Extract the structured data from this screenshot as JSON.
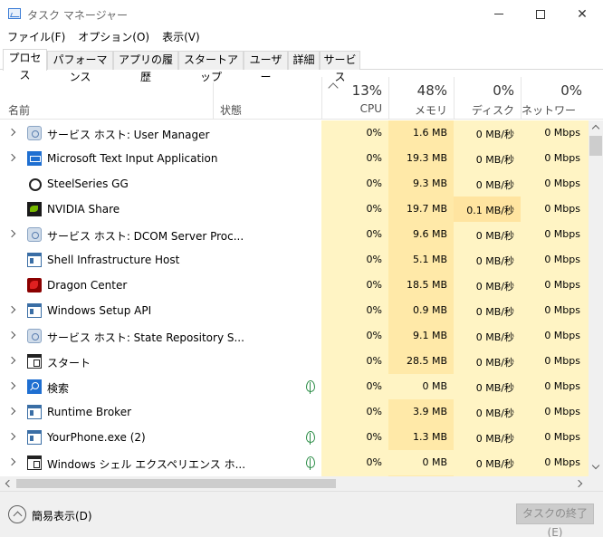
{
  "window": {
    "title": "タスク マネージャー",
    "minimize_icon": "minimize-icon",
    "maximize_icon": "maximize-icon",
    "close_glyph": "✕"
  },
  "menu": [
    "ファイル(F)",
    "オプション(O)",
    "表示(V)"
  ],
  "tabs": [
    "プロセス",
    "パフォーマンス",
    "アプリの履歴",
    "スタートアップ",
    "ユーザー",
    "詳細",
    "サービス"
  ],
  "active_tab": "プロセス",
  "columns": {
    "name": "名前",
    "status": "状態",
    "cpu": {
      "pct": "13%",
      "label": "CPU"
    },
    "memory": {
      "pct": "48%",
      "label": "メモリ"
    },
    "disk": {
      "pct": "0%",
      "label": "ディスク"
    },
    "network": {
      "pct": "0%",
      "label": "ネットワーク"
    }
  },
  "colors": {
    "cpu_column_bg": "#fff4c4",
    "memory_column_bg": "#ffe9a8",
    "highlight_cell_bg": "#ffe4a0",
    "status_leaf": "#2f8f4a"
  },
  "processes": [
    {
      "expandable": true,
      "icon": "gear-icon",
      "name": "サービス ホスト: User Manager",
      "suspended": false,
      "cpu": "0%",
      "memory": "1.6 MB",
      "disk": "0 MB/秒",
      "network": "0 Mbps"
    },
    {
      "expandable": true,
      "icon": "keyboard-icon",
      "name": "Microsoft Text Input Application",
      "suspended": false,
      "cpu": "0%",
      "memory": "19.3 MB",
      "disk": "0 MB/秒",
      "network": "0 Mbps"
    },
    {
      "expandable": false,
      "icon": "steelseries-icon",
      "name": "SteelSeries GG",
      "suspended": false,
      "cpu": "0%",
      "memory": "9.3 MB",
      "disk": "0 MB/秒",
      "network": "0 Mbps"
    },
    {
      "expandable": false,
      "icon": "nvidia-icon",
      "name": "NVIDIA Share",
      "suspended": false,
      "cpu": "0%",
      "memory": "19.7 MB",
      "disk": "0.1 MB/秒",
      "network": "0 Mbps"
    },
    {
      "expandable": true,
      "icon": "gear-icon",
      "name": "サービス ホスト: DCOM Server Proc...",
      "suspended": false,
      "cpu": "0%",
      "memory": "9.6 MB",
      "disk": "0 MB/秒",
      "network": "0 Mbps"
    },
    {
      "expandable": false,
      "icon": "window-icon",
      "name": "Shell Infrastructure Host",
      "suspended": false,
      "cpu": "0%",
      "memory": "5.1 MB",
      "disk": "0 MB/秒",
      "network": "0 Mbps"
    },
    {
      "expandable": false,
      "icon": "dragon-icon",
      "name": "Dragon Center",
      "suspended": false,
      "cpu": "0%",
      "memory": "18.5 MB",
      "disk": "0 MB/秒",
      "network": "0 Mbps"
    },
    {
      "expandable": true,
      "icon": "window-icon",
      "name": "Windows Setup API",
      "suspended": false,
      "cpu": "0%",
      "memory": "0.9 MB",
      "disk": "0 MB/秒",
      "network": "0 Mbps"
    },
    {
      "expandable": true,
      "icon": "gear-icon",
      "name": "サービス ホスト: State Repository S...",
      "suspended": false,
      "cpu": "0%",
      "memory": "9.1 MB",
      "disk": "0 MB/秒",
      "network": "0 Mbps"
    },
    {
      "expandable": true,
      "icon": "start-icon",
      "name": "スタート",
      "suspended": false,
      "cpu": "0%",
      "memory": "28.5 MB",
      "disk": "0 MB/秒",
      "network": "0 Mbps"
    },
    {
      "expandable": true,
      "icon": "search-icon",
      "name": "検索",
      "suspended": true,
      "cpu": "0%",
      "memory": "0 MB",
      "disk": "0 MB/秒",
      "network": "0 Mbps"
    },
    {
      "expandable": true,
      "icon": "window-icon",
      "name": "Runtime Broker",
      "suspended": false,
      "cpu": "0%",
      "memory": "3.9 MB",
      "disk": "0 MB/秒",
      "network": "0 Mbps"
    },
    {
      "expandable": true,
      "icon": "window-icon",
      "name": "YourPhone.exe (2)",
      "suspended": true,
      "cpu": "0%",
      "memory": "1.3 MB",
      "disk": "0 MB/秒",
      "network": "0 Mbps"
    },
    {
      "expandable": true,
      "icon": "start-icon",
      "name": "Windows シェル エクスペリエンス ホ...",
      "suspended": true,
      "cpu": "0%",
      "memory": "0 MB",
      "disk": "0 MB/秒",
      "network": "0 Mbps"
    }
  ],
  "footer": {
    "fewer_details": "簡易表示(D)",
    "end_task": "タスクの終了(E)"
  }
}
